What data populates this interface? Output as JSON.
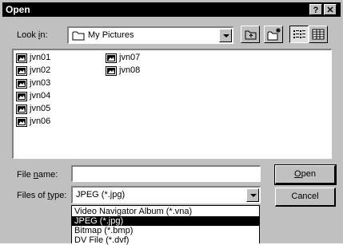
{
  "window": {
    "title": "Open",
    "help_label": "?",
    "close_label": "✕"
  },
  "lookin": {
    "label_pre": "Look ",
    "label_key": "i",
    "label_post": "n:",
    "value": "My Pictures"
  },
  "files": [
    "jvn01",
    "jvn02",
    "jvn03",
    "jvn04",
    "jvn05",
    "jvn06",
    "jvn07",
    "jvn08"
  ],
  "filename": {
    "label_pre": "File ",
    "label_key": "n",
    "label_post": "ame:",
    "value": ""
  },
  "filetype": {
    "label_pre": "Files of ",
    "label_key": "t",
    "label_post": "ype:",
    "value": "JPEG (*.jpg)",
    "options": [
      "Video Navigator Album (*.vna)",
      "JPEG (*.jpg)",
      "Bitmap (*.bmp)",
      "DV File (*.dvf)"
    ],
    "selected_option": "JPEG (*.jpg)"
  },
  "buttons": {
    "open_key": "O",
    "open_rest": "pen",
    "cancel": "Cancel"
  },
  "colors": {
    "titlebar": "#000000",
    "face": "#c0c0c0",
    "selection": "#000000"
  },
  "icons": {
    "folder": "folder-icon",
    "up": "up-one-level-icon",
    "new_folder": "new-folder-icon",
    "list": "list-view-icon",
    "details": "details-view-icon",
    "image": "image-file-icon"
  }
}
